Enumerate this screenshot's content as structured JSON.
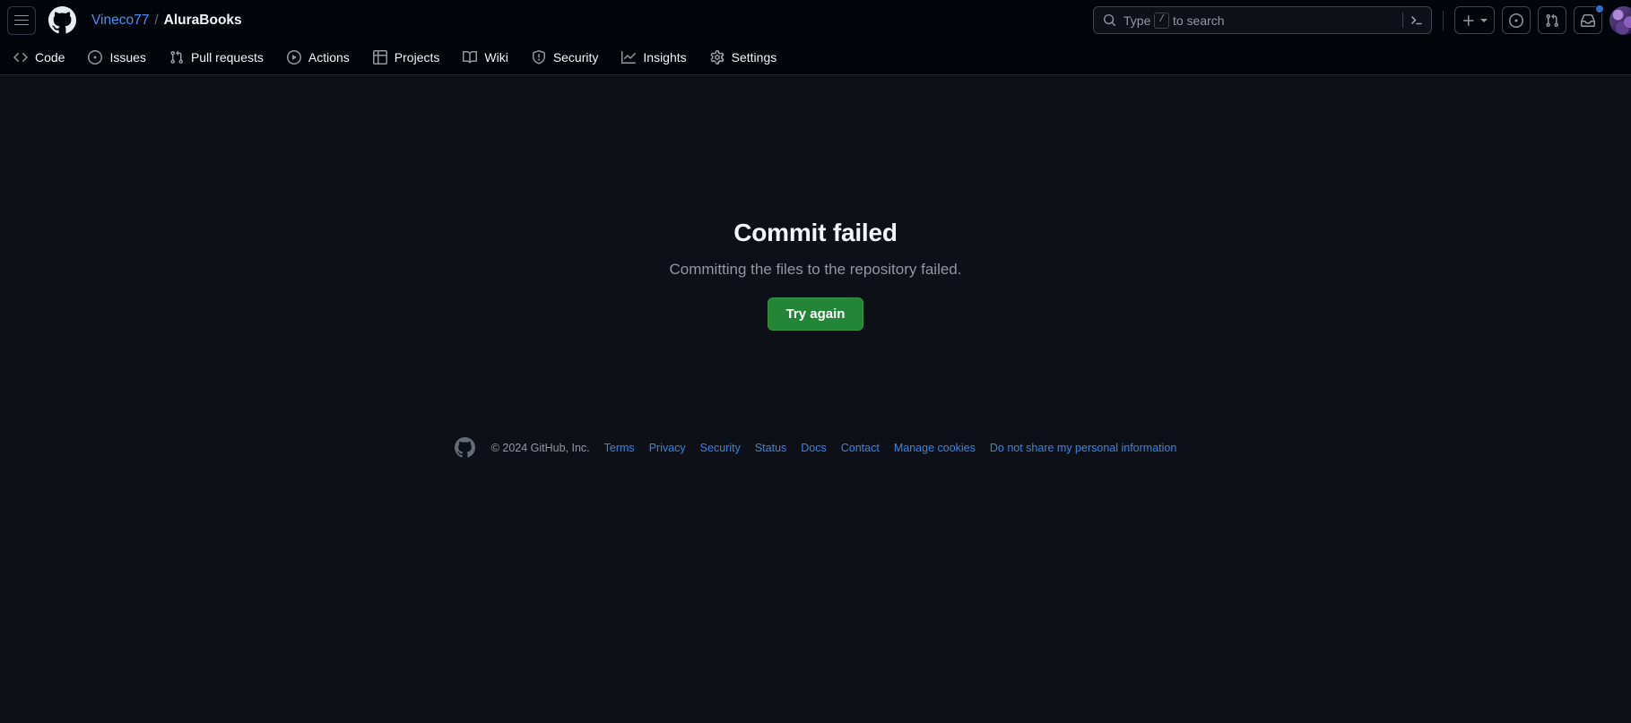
{
  "header": {
    "menu_icon": "hamburger-menu-icon",
    "logo_icon": "github-logo-icon",
    "breadcrumb": {
      "owner": "Vineco77",
      "separator": "/",
      "repo": "AluraBooks"
    },
    "search": {
      "placeholder_prefix": "Type",
      "key_hint": "/",
      "placeholder_suffix": "to search",
      "value": "",
      "terminal_icon": "command-palette-icon",
      "search_icon": "search-icon"
    },
    "actions": {
      "create_new_label": "+",
      "create_new_icon": "plus-icon",
      "issues_icon": "issue-opened-icon",
      "pull_requests_icon": "git-pull-request-icon",
      "notifications_icon": "inbox-icon",
      "has_unread_notifications": true,
      "avatar_icon": "user-avatar"
    }
  },
  "repo_nav": {
    "items": [
      {
        "label": "Code",
        "icon": "code-icon"
      },
      {
        "label": "Issues",
        "icon": "issue-opened-icon"
      },
      {
        "label": "Pull requests",
        "icon": "git-pull-request-icon"
      },
      {
        "label": "Actions",
        "icon": "play-icon"
      },
      {
        "label": "Projects",
        "icon": "table-icon"
      },
      {
        "label": "Wiki",
        "icon": "book-icon"
      },
      {
        "label": "Security",
        "icon": "shield-icon"
      },
      {
        "label": "Insights",
        "icon": "graph-icon"
      },
      {
        "label": "Settings",
        "icon": "gear-icon"
      }
    ]
  },
  "main": {
    "title": "Commit failed",
    "description": "Committing the files to the repository failed.",
    "retry_label": "Try again"
  },
  "footer": {
    "mark_icon": "github-mark-icon",
    "copyright": "© 2024 GitHub, Inc.",
    "links": [
      {
        "label": "Terms"
      },
      {
        "label": "Privacy"
      },
      {
        "label": "Security"
      },
      {
        "label": "Status"
      },
      {
        "label": "Docs"
      },
      {
        "label": "Contact"
      },
      {
        "label": "Manage cookies"
      },
      {
        "label": "Do not share my personal information"
      }
    ]
  },
  "colors": {
    "page_bg": "#0d1117",
    "header_bg": "#010409",
    "accent_link": "#4493f8",
    "success_button": "#238636",
    "muted_text": "#9198a1",
    "border": "#3d444d",
    "notification_dot": "#316dca"
  }
}
